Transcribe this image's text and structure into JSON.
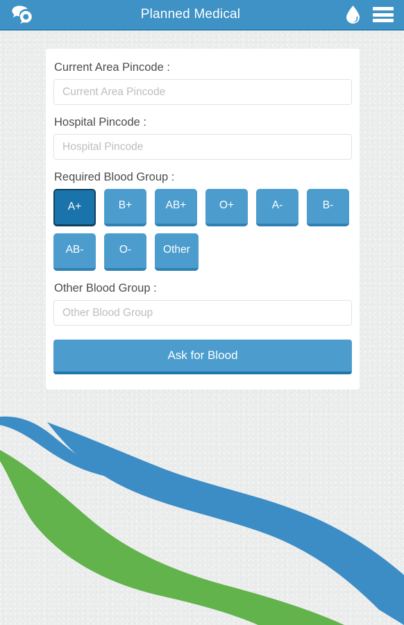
{
  "header": {
    "title": "Planned Medical",
    "left_icon": "chat-bubbles-icon",
    "drop_icon": "blood-drop-icon",
    "menu_icon": "hamburger-menu-icon",
    "background_color": "#3e92c6"
  },
  "form": {
    "current_pincode": {
      "label": "Current Area Pincode :",
      "placeholder": "Current Area Pincode",
      "value": ""
    },
    "hospital_pincode": {
      "label": "Hospital Pincode :",
      "placeholder": "Hospital Pincode",
      "value": ""
    },
    "blood_group": {
      "label": "Required Blood Group :",
      "selected": "A+",
      "options": [
        "A+",
        "B+",
        "AB+",
        "O+",
        "A-",
        "B-",
        "AB-",
        "O-",
        "Other"
      ]
    },
    "other_blood_group": {
      "label": "Other Blood Group :",
      "placeholder": "Other Blood Group",
      "value": ""
    },
    "submit_label": "Ask for Blood"
  },
  "theme": {
    "accent_blue": "#4c9dcd",
    "accent_blue_dark": "#1a74ab",
    "wave_blue": "#3c8dc5",
    "wave_green": "#62b34c",
    "page_background": "#ebecec"
  }
}
